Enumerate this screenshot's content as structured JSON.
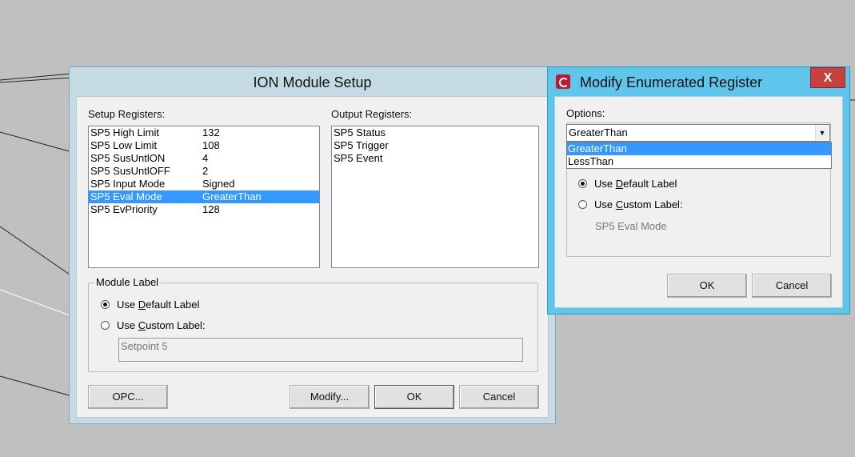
{
  "ion_setup": {
    "title": "ION Module Setup",
    "setup_registers_label": "Setup Registers:",
    "output_registers_label": "Output Registers:",
    "setup_registers": [
      {
        "name": "SP5 High Limit",
        "value": "132"
      },
      {
        "name": "SP5 Low Limit",
        "value": "108"
      },
      {
        "name": "SP5 SusUntlON",
        "value": "4"
      },
      {
        "name": "SP5 SusUntlOFF",
        "value": "2"
      },
      {
        "name": "SP5 Input Mode",
        "value": "Signed"
      },
      {
        "name": "SP5 Eval Mode",
        "value": "GreaterThan"
      },
      {
        "name": "SP5 EvPriority",
        "value": "128"
      }
    ],
    "selected_setup_index": 5,
    "output_registers": [
      "SP5 Status",
      "SP5 Trigger",
      "SP5 Event"
    ],
    "module_label_group": "Module Label",
    "use_default_label": {
      "pre": "Use ",
      "key": "D",
      "post": "efault Label"
    },
    "use_custom_label": {
      "pre": "Use ",
      "key": "C",
      "post": "ustom Label:"
    },
    "custom_label_value": "Setpoint 5",
    "buttons": {
      "opc": "OPC...",
      "modify": "Modify...",
      "ok": "OK",
      "cancel": "Cancel"
    }
  },
  "modify_enum": {
    "title": "Modify Enumerated Register",
    "close_glyph": "X",
    "options_label": "Options:",
    "selected_option": "GreaterThan",
    "options": [
      "GreaterThan",
      "LessThan"
    ],
    "selected_option_index": 0,
    "use_default_label": {
      "pre": "Use ",
      "key": "D",
      "post": "efault Label"
    },
    "use_custom_label": {
      "pre": "Use ",
      "key": "C",
      "post": "ustom Label:"
    },
    "custom_label_value": "SP5 Eval Mode",
    "buttons": {
      "ok": "OK",
      "cancel": "Cancel"
    }
  },
  "colors": {
    "selection": "#3399ff",
    "ion_titlebar": "#c4dbe3",
    "modify_titlebar": "#5fc5ea",
    "close_button": "#c7413f",
    "desktop": "#c0c0c0"
  }
}
